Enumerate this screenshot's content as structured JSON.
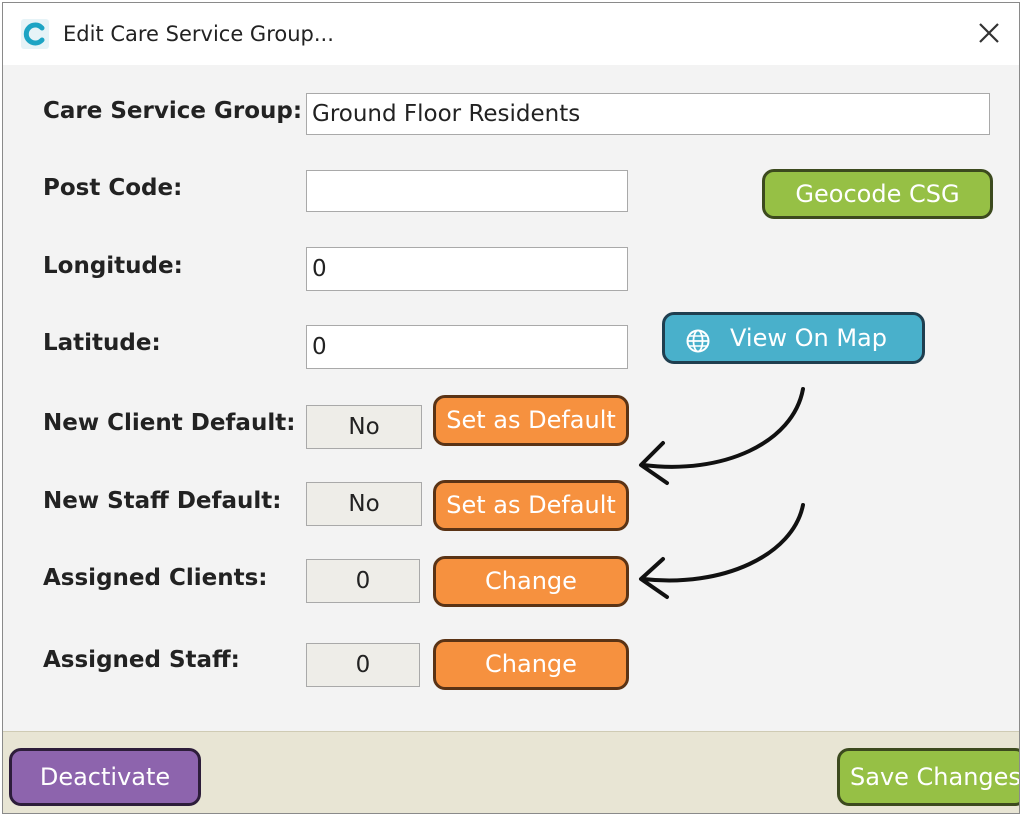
{
  "window": {
    "title": "Edit Care Service Group..."
  },
  "form": {
    "care_service_group": {
      "label": "Care Service Group:",
      "value": "Ground Floor Residents"
    },
    "post_code": {
      "label": "Post Code:",
      "value": ""
    },
    "longitude": {
      "label": "Longitude:",
      "value": "0"
    },
    "latitude": {
      "label": "Latitude:",
      "value": "0"
    },
    "new_client_default": {
      "label": "New Client Default:",
      "value": "No",
      "button": "Set as Default"
    },
    "new_staff_default": {
      "label": "New Staff Default:",
      "value": "No",
      "button": "Set as Default"
    },
    "assigned_clients": {
      "label": "Assigned Clients:",
      "value": "0",
      "button": "Change"
    },
    "assigned_staff": {
      "label": "Assigned Staff:",
      "value": "0",
      "button": "Change"
    }
  },
  "buttons": {
    "geocode": "Geocode CSG",
    "view_on_map": "View On Map",
    "deactivate": "Deactivate",
    "save_changes": "Save Changes"
  },
  "icons": {
    "app_logo": "app-logo-c",
    "close": "close-icon",
    "globe": "globe-icon"
  },
  "colors": {
    "orange_button": "#f6913f",
    "green_button": "#96c045",
    "blue_button": "#49b0cb",
    "purple_button": "#8d64ad",
    "footer": "#e8e5d4"
  }
}
